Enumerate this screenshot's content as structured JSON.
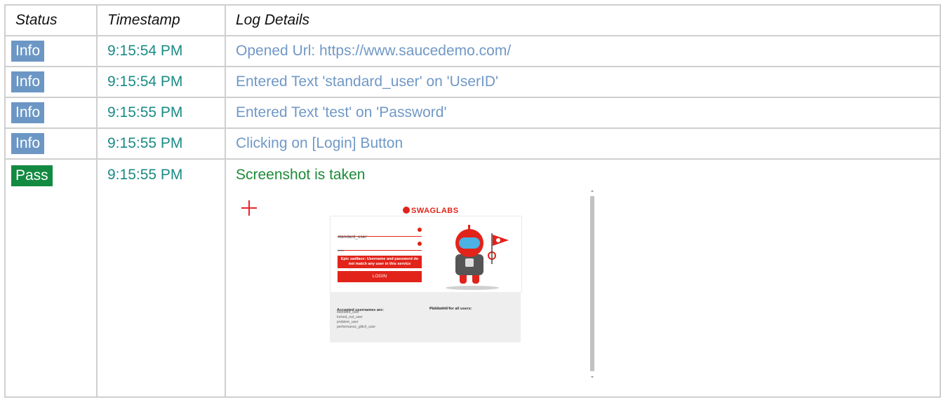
{
  "headers": {
    "status": "Status",
    "timestamp": "Timestamp",
    "details": "Log Details"
  },
  "entries": [
    {
      "status": "Info",
      "time": "9:15:54 PM",
      "details": "Opened Url: https://www.saucedemo.com/"
    },
    {
      "status": "Info",
      "time": "9:15:54 PM",
      "details": "Entered Text 'standard_user' on 'UserID'"
    },
    {
      "status": "Info",
      "time": "9:15:55 PM",
      "details": "Entered Text 'test' on 'Password'"
    },
    {
      "status": "Info",
      "time": "9:15:55 PM",
      "details": "Clicking on [Login] Button"
    },
    {
      "status": "Pass",
      "time": "9:15:55 PM",
      "details": "Screenshot is taken"
    }
  ],
  "screenshot": {
    "brand": "SWAGLABS",
    "username_value": "standard_user",
    "password_value": "••••",
    "error_text": "Epic sadface: Username and password do not match any user in this service",
    "login_label": "LOGIN",
    "accepted_heading": "Accepted usernames are:",
    "accepted_list": "standard_user\nlocked_out_user\nproblem_user\nperformance_glitch_user",
    "password_heading": "Password for all users:",
    "password_list": "secret_sauce"
  },
  "colors": {
    "info": "#6c97c5",
    "pass": "#138a41",
    "timestamp": "#1a8b85",
    "brand": "#e2231a"
  }
}
